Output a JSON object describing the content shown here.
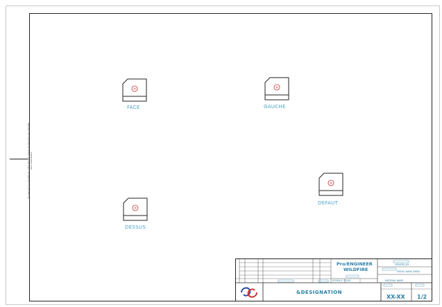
{
  "views": [
    {
      "id": "face",
      "label": "FACE"
    },
    {
      "id": "gauche",
      "label": "GAUCHE"
    },
    {
      "id": "defaut",
      "label": "DEFAUT"
    },
    {
      "id": "dessus",
      "label": "DESSUS"
    }
  ],
  "side_note": {
    "line1": "Ce plan est la propriété de notre société, toute reproduction est interdite",
    "line2": "sans autorisation"
  },
  "title_block": {
    "pro_line1": "Pro/ENGINEER",
    "pro_line2": "WILDFIRE",
    "designation": "&DESIGNATION",
    "designation_sub": "-",
    "number": "XX-XX",
    "sheet": "1/2",
    "cells": {
      "created_by": "CREATED_BY",
      "model_name": "MODEL NAME (DRW)",
      "scale": "ECHELLE: SCALE",
      "material": "MATERIAL NAME"
    }
  },
  "colors": {
    "label_color": "#4aa3c6",
    "center_mark": "#c33",
    "title_text": "#2a7fa6"
  }
}
